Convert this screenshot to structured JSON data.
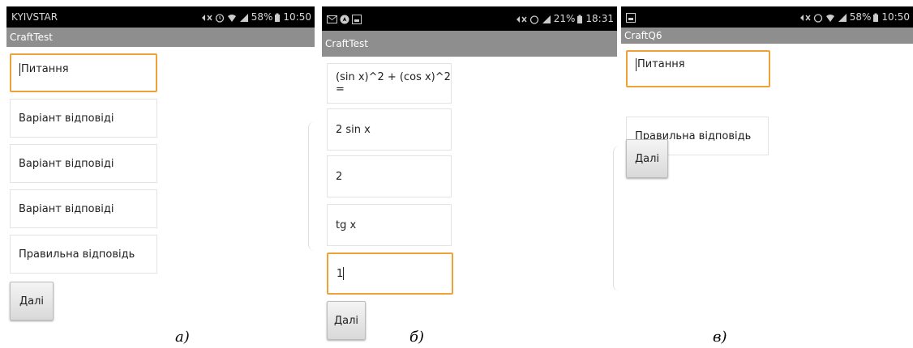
{
  "screens": [
    {
      "status": {
        "carrier": "KYIVSTAR",
        "battery": "58%",
        "time": "10:50"
      },
      "app_title": "CraftTest",
      "fields": [
        {
          "value": "Питання",
          "focused": true
        },
        {
          "value": "Варіант відповіді",
          "focused": false
        },
        {
          "value": "Варіант відповіді",
          "focused": false
        },
        {
          "value": "Варіант відповіді",
          "focused": false
        },
        {
          "value": "Правильна відповідь",
          "focused": false
        }
      ],
      "button_label": "Далі",
      "caption": "а)"
    },
    {
      "status": {
        "carrier": "",
        "battery": "21%",
        "time": "18:31"
      },
      "app_title": "CraftTest",
      "fields": [
        {
          "value": "(sin x)^2 + (cos x)^2 =",
          "focused": false
        },
        {
          "value": "2 sin x",
          "focused": false
        },
        {
          "value": "2",
          "focused": false
        },
        {
          "value": "tg x",
          "focused": false
        },
        {
          "value": "1",
          "focused": true
        }
      ],
      "button_label": "Далі",
      "caption": "б)"
    },
    {
      "status": {
        "carrier": "",
        "battery": "58%",
        "time": "10:50"
      },
      "app_title": "CraftQ6",
      "fields": [
        {
          "value": "Питання",
          "focused": true
        },
        {
          "value": "Правильна відповідь",
          "focused": false
        }
      ],
      "button_label": "Далі",
      "caption": "в)"
    }
  ],
  "colors": {
    "statusbar": "#000000",
    "titlebar": "#8e8e8e",
    "focus": "#f0a23a"
  },
  "icons": [
    "notification-mute-icon",
    "alarm-icon",
    "wifi-icon",
    "signal-icon",
    "battery-icon",
    "mail-icon",
    "image-icon"
  ]
}
